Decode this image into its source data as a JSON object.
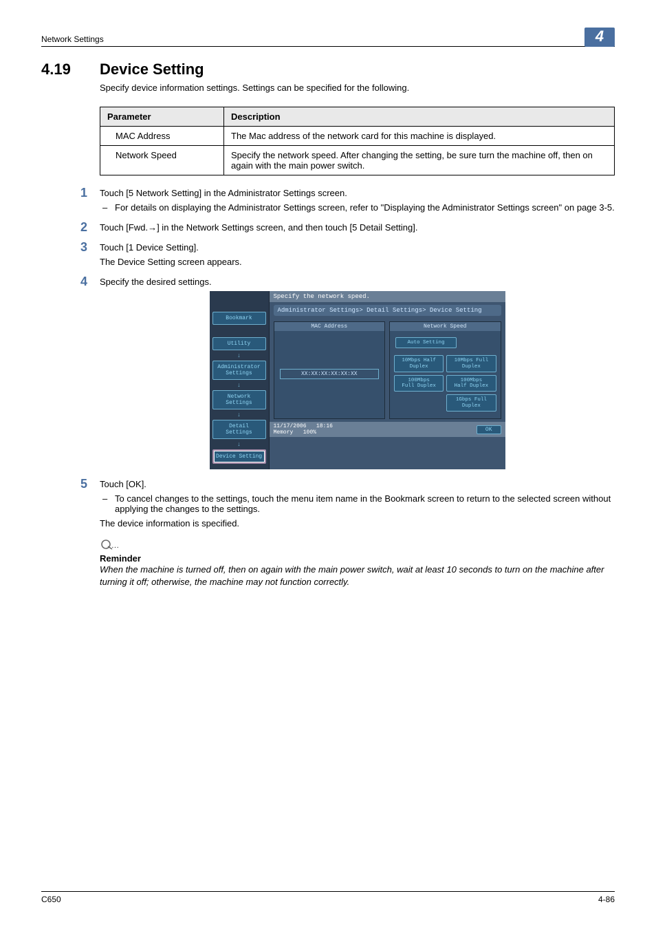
{
  "header": {
    "section_name": "Network Settings",
    "chapter_number": "4"
  },
  "section": {
    "number": "4.19",
    "title": "Device Setting",
    "intro": "Specify device information settings. Settings can be specified for the following."
  },
  "param_table": {
    "head": {
      "param": "Parameter",
      "desc": "Description"
    },
    "rows": [
      {
        "param": "MAC Address",
        "desc": "The Mac address of the network card for this machine is displayed."
      },
      {
        "param": "Network Speed",
        "desc": "Specify the network speed. After changing the setting, be sure turn the machine off, then on again with the main power switch."
      }
    ]
  },
  "steps": {
    "s1": {
      "num": "1",
      "text": "Touch [5 Network Setting] in the Administrator Settings screen.",
      "sub": "For details on displaying the Administrator Settings screen, refer to \"Displaying the Administrator Settings screen\" on page 3-5."
    },
    "s2": {
      "num": "2",
      "text": "Touch [Fwd.→] in the Network Settings screen, and then touch [5 Detail Setting]."
    },
    "s3": {
      "num": "3",
      "text": "Touch [1 Device Setting].",
      "follow": "The Device Setting screen appears."
    },
    "s4": {
      "num": "4",
      "text": "Specify the desired settings."
    },
    "s5": {
      "num": "5",
      "text": "Touch [OK].",
      "sub": "To cancel changes to the settings, touch the menu item name in the Bookmark screen to return to the selected screen without applying the changes to the settings.",
      "follow": "The device information is specified."
    }
  },
  "device_ui": {
    "topbar": "Specify the network speed.",
    "bookmark": "Bookmark",
    "sidebar": {
      "utility": "Utility",
      "admin": "Administrator\nSettings",
      "network": "Network\nSettings",
      "detail": "Detail\nSettings",
      "device": "Device Setting"
    },
    "breadcrumb": "Administrator Settings> Detail Settings> Device Setting",
    "left_pane": {
      "header": "MAC Address",
      "value": "XX:XX:XX:XX:XX:XX"
    },
    "right_pane": {
      "header": "Network Speed",
      "options": {
        "auto": "Auto Setting",
        "o10h": "10Mbps Half Duplex",
        "o10f": "10Mbps Full Duplex",
        "o100f": "100Mbps\nFull Duplex",
        "o100h": "100Mbps\nHalf Duplex",
        "o1g": "1Gbps Full Duplex"
      }
    },
    "footer": {
      "date": "11/17/2006",
      "time": "18:16",
      "mem_label": "Memory",
      "mem_val": "100%",
      "ok": "OK"
    }
  },
  "note": {
    "title": "Reminder",
    "text": "When the machine is turned off, then on again with the main power switch, wait at least 10 seconds to turn on the machine after turning it off; otherwise, the machine may not function correctly."
  },
  "footer": {
    "left": "C650",
    "right": "4-86"
  }
}
